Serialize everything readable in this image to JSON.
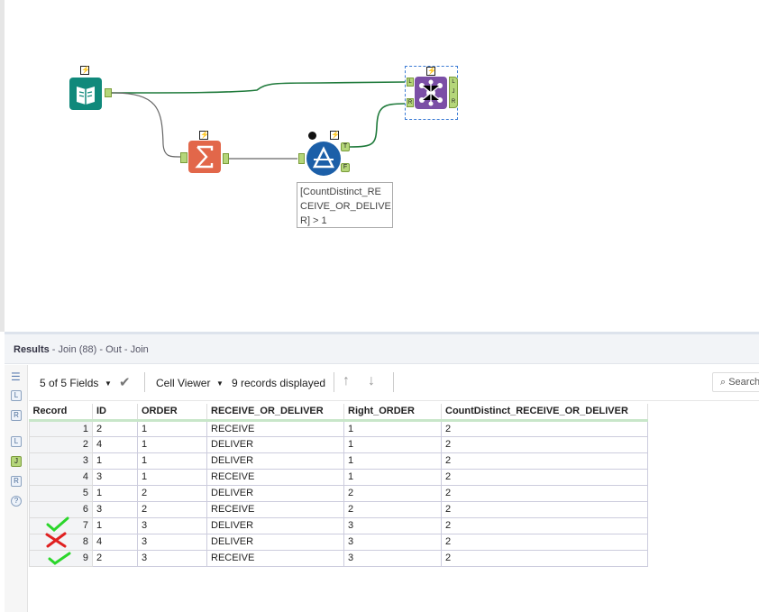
{
  "workflow": {
    "filter_expression_line1": "[CountDistinct_RE",
    "filter_expression_line2": "CEIVE_OR_DELIVE",
    "filter_expression_line3": "R] > 1",
    "anchors": {
      "left": "L",
      "join": "J",
      "right": "R",
      "true": "T",
      "false": "F"
    }
  },
  "results": {
    "title": "Results",
    "subtitle": " - Join (88) - Out - Join",
    "fields_selector": "5 of 5 Fields",
    "viewer": "Cell Viewer",
    "records_displayed": "9 records displayed",
    "search_placeholder": "Search",
    "side_icons": [
      "L",
      "R",
      "L",
      "J",
      "R",
      "?"
    ],
    "columns": [
      "Record",
      "ID",
      "ORDER",
      "RECEIVE_OR_DELIVER",
      "Right_ORDER",
      "CountDistinct_RECEIVE_OR_DELIVER"
    ],
    "rows": [
      [
        "1",
        "2",
        "1",
        "RECEIVE",
        "1",
        "2"
      ],
      [
        "2",
        "4",
        "1",
        "DELIVER",
        "1",
        "2"
      ],
      [
        "3",
        "1",
        "1",
        "DELIVER",
        "1",
        "2"
      ],
      [
        "4",
        "3",
        "1",
        "RECEIVE",
        "1",
        "2"
      ],
      [
        "5",
        "1",
        "2",
        "DELIVER",
        "2",
        "2"
      ],
      [
        "6",
        "3",
        "2",
        "RECEIVE",
        "2",
        "2"
      ],
      [
        "7",
        "1",
        "3",
        "DELIVER",
        "3",
        "2"
      ],
      [
        "8",
        "4",
        "3",
        "DELIVER",
        "3",
        "2"
      ],
      [
        "9",
        "2",
        "3",
        "RECEIVE",
        "3",
        "2"
      ]
    ],
    "annotations": {
      "row7": "check",
      "row8": "cross",
      "row9": "check"
    }
  }
}
